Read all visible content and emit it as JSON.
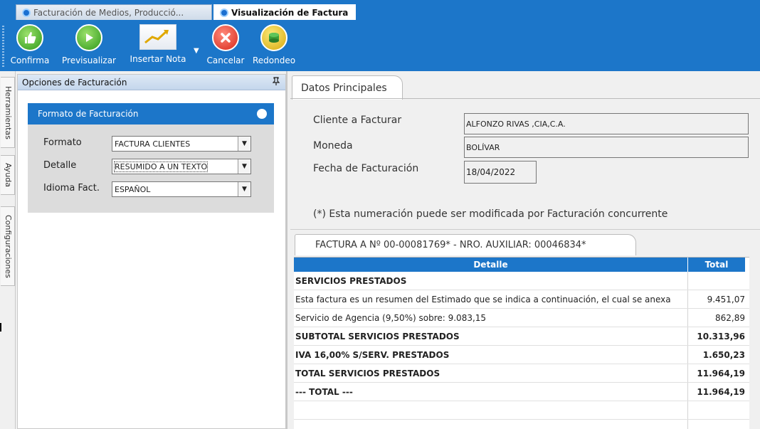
{
  "tabs": [
    {
      "label": "Facturación de Medios, Producció..."
    },
    {
      "label": "Visualización de Factura"
    }
  ],
  "toolbar": {
    "confirma": "Confirma",
    "previsualizar": "Previsualizar",
    "insertar_nota": "Insertar Nota",
    "cancelar": "Cancelar",
    "redondeo": "Redondeo"
  },
  "side_tabs": {
    "herramientas": "Herramientas",
    "ayuda": "Ayuda",
    "configuraciones": "Configuraciones"
  },
  "options_panel": {
    "title": "Opciones de Facturación",
    "card_title": "Formato de Facturación",
    "formato_label": "Formato",
    "formato_value": "FACTURA CLIENTES",
    "detalle_label": "Detalle",
    "detalle_value": "RESUMIDO A UN TEXTO",
    "idioma_label": "Idioma Fact.",
    "idioma_value": "ESPAÑOL"
  },
  "datos": {
    "tab": "Datos Principales",
    "cliente_label": "Cliente a Facturar",
    "cliente_value": "ALFONZO RIVAS ,CIA,C.A.",
    "moneda_label": "Moneda",
    "moneda_value": "BOLÍVAR",
    "fecha_label": "Fecha de Facturación",
    "fecha_value": "18/04/2022",
    "note": "(*) Esta numeración puede ser modificada por Facturación concurrente"
  },
  "factura": {
    "tab": "FACTURA A Nº 00-00081769* - NRO. AUXILIAR: 00046834*",
    "col_detalle": "Detalle",
    "col_total": "Total",
    "rows": [
      {
        "detalle": "SERVICIOS PRESTADOS",
        "total": ""
      },
      {
        "detalle": "Esta factura es un resumen del Estimado que se indica a continuación, el cual se anexa",
        "total": "9.451,07"
      },
      {
        "detalle": "Servicio de Agencia (9,50%) sobre: 9.083,15",
        "total": "862,89"
      },
      {
        "detalle": "SUBTOTAL SERVICIOS PRESTADOS",
        "total": "10.313,96"
      },
      {
        "detalle": "IVA 16,00% S/SERV. PRESTADOS",
        "total": "1.650,23"
      },
      {
        "detalle": "TOTAL SERVICIOS PRESTADOS",
        "total": "11.964,19"
      },
      {
        "detalle": "--- TOTAL ---",
        "total": "11.964,19"
      },
      {
        "detalle": "",
        "total": ""
      }
    ]
  },
  "colors": {
    "accent": "#1c76c9",
    "card_bg": "#dcdcdc"
  }
}
